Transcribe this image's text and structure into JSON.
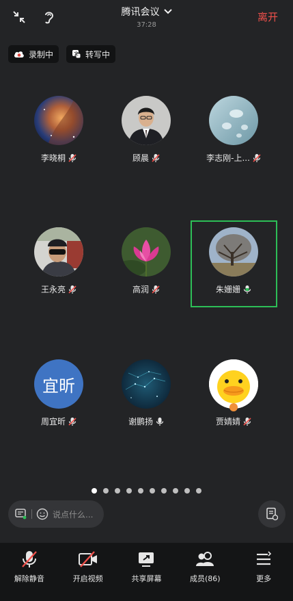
{
  "header": {
    "title": "腾讯会议",
    "timer": "37:28",
    "leave_label": "离开"
  },
  "chips": {
    "recording": "录制中",
    "transcribing": "转写中"
  },
  "participants": [
    {
      "name": "李晓桐",
      "mic": "muted",
      "avatar": "space-icon"
    },
    {
      "name": "顾晨",
      "mic": "muted",
      "avatar": "person-suit-icon"
    },
    {
      "name": "李志刚-上...",
      "mic": "muted",
      "avatar": "water-drops-icon"
    },
    {
      "name": "王永亮",
      "mic": "muted",
      "avatar": "person-sunglasses-icon"
    },
    {
      "name": "高润",
      "mic": "muted",
      "avatar": "lotus-icon"
    },
    {
      "name": "朱姗姗",
      "mic": "active",
      "avatar": "tree-icon"
    },
    {
      "name": "周宜昕",
      "mic": "muted",
      "avatar": "text-avatar",
      "avatar_text": "宜昕"
    },
    {
      "name": "谢鹏扬",
      "mic": "on",
      "avatar": "starfield-icon"
    },
    {
      "name": "贾婧婧",
      "mic": "muted",
      "avatar": "duck-icon"
    }
  ],
  "pagination": {
    "pages": 10,
    "current": 1
  },
  "chat": {
    "placeholder": "说点什么..."
  },
  "toolbar": {
    "unmute": "解除静音",
    "start_video": "开启视频",
    "share_screen": "共享屏幕",
    "members": "成员(86)",
    "more": "更多"
  },
  "colors": {
    "leave": "#f0504b",
    "active_speaker": "#2dbf57",
    "muted_slash": "#f0504b",
    "background": "#232426"
  }
}
